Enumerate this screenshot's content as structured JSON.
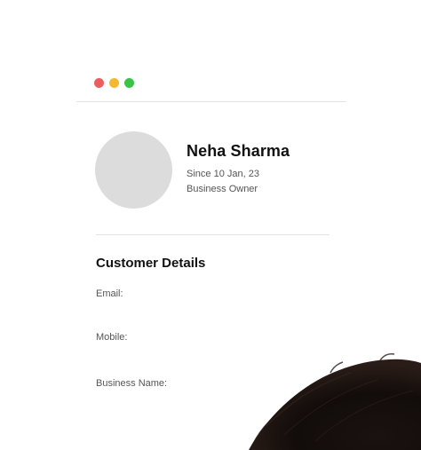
{
  "window": {
    "controls": {
      "close_color": "#ec5e5e",
      "minimize_color": "#f4b732",
      "maximize_color": "#39c348"
    }
  },
  "profile": {
    "name": "Neha Sharma",
    "since": "Since 10 Jan, 23",
    "role": "Business Owner"
  },
  "customer_details": {
    "title": "Customer Details",
    "fields": [
      {
        "label": "Email:"
      },
      {
        "label": "Mobile:"
      },
      {
        "label": "Business Name:"
      }
    ]
  },
  "decor": {
    "image": "woman-hair-photo"
  }
}
